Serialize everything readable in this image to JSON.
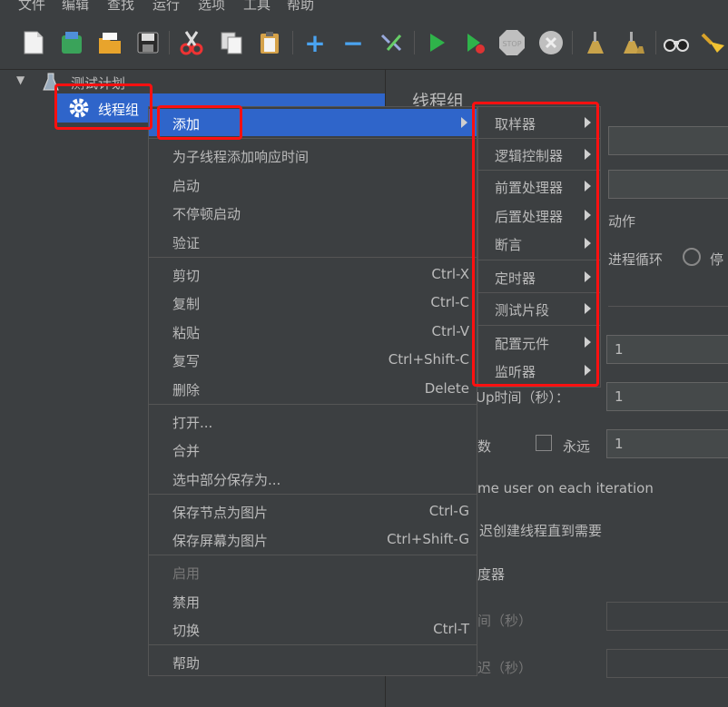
{
  "menubar": [
    "文件",
    "编辑",
    "查找",
    "运行",
    "选项",
    "工具",
    "帮助"
  ],
  "tree": {
    "plan": "测试计划",
    "thread_group": "线程组"
  },
  "right": {
    "title": "线程组",
    "action_label": "动作",
    "continue_loop": "进程循环",
    "stop_partial": "停",
    "ramp_up_label": "Up时间（秒）：",
    "ramp_up_value": "1",
    "threads_value": "1",
    "loop_label": "数",
    "forever_label": "永远",
    "loop_value": "1",
    "same_user": "me user on each iteration",
    "delay_create": "迟创建线程直到需要",
    "scheduler": "度器",
    "duration": "间（秒）",
    "startup_delay": "迟（秒）"
  },
  "context_menu": {
    "add": "添加",
    "add_response_time": "为子线程添加响应时间",
    "start": "启动",
    "start_no_pause": "不停顿启动",
    "validate": "验证",
    "cut": "剪切",
    "cut_sc": "Ctrl-X",
    "copy": "复制",
    "copy_sc": "Ctrl-C",
    "paste": "粘贴",
    "paste_sc": "Ctrl-V",
    "duplicate": "复写",
    "duplicate_sc": "Ctrl+Shift-C",
    "delete": "删除",
    "delete_sc": "Delete",
    "open": "打开...",
    "merge": "合并",
    "save_selection": "选中部分保存为...",
    "save_node_img": "保存节点为图片",
    "save_node_img_sc": "Ctrl-G",
    "save_screen_img": "保存屏幕为图片",
    "save_screen_img_sc": "Ctrl+Shift-G",
    "enable": "启用",
    "disable": "禁用",
    "toggle": "切换",
    "toggle_sc": "Ctrl-T",
    "help": "帮助"
  },
  "submenu": [
    "取样器",
    "逻辑控制器",
    "前置处理器",
    "后置处理器",
    "断言",
    "定时器",
    "测试片段",
    "配置元件",
    "监听器"
  ],
  "colors": {
    "highlight": "#2f65ca",
    "annotation": "#ff1010",
    "background": "#3c3f41"
  }
}
